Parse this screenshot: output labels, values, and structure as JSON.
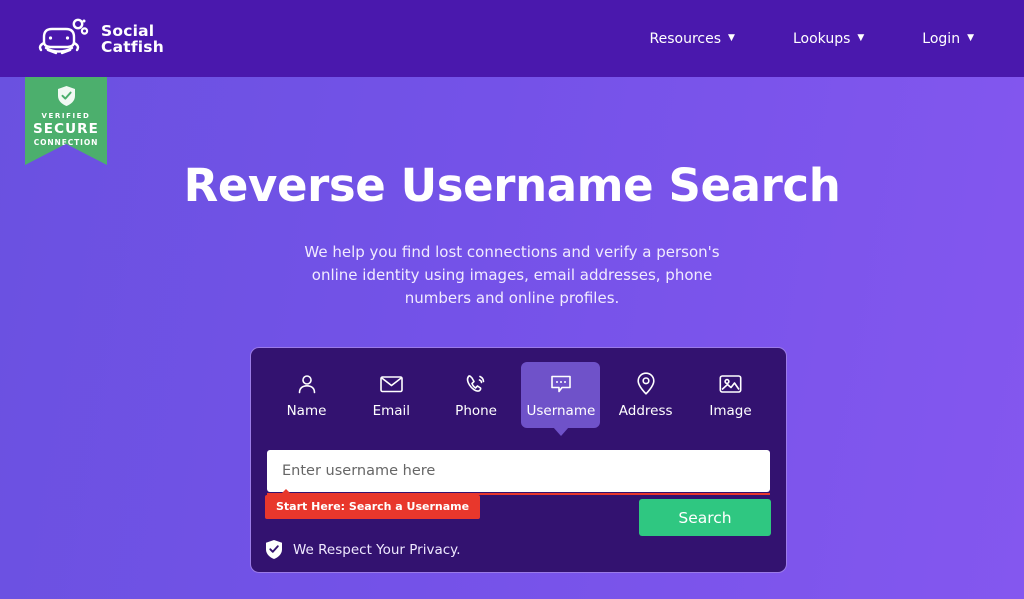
{
  "header": {
    "logo": {
      "icon": "catfish-logo-icon",
      "line1": "Social",
      "line2": "Catfish"
    },
    "nav": [
      {
        "label": "Resources",
        "caret": "▼"
      },
      {
        "label": "Lookups",
        "caret": "▼"
      },
      {
        "label": "Login",
        "caret": "▼"
      }
    ]
  },
  "secure_badge": {
    "icon": "shield-check-icon",
    "line1": "VERIFIED",
    "line2": "SECURE",
    "line3": "CONNECTION",
    "color": "#4caf6d"
  },
  "hero": {
    "title": "Reverse Username Search",
    "subtitle": "We help you find lost connections and verify a person's online identity using images, email addresses, phone numbers and online profiles."
  },
  "search_card": {
    "tabs": [
      {
        "label": "Name",
        "icon": "person-icon",
        "active": false
      },
      {
        "label": "Email",
        "icon": "envelope-icon",
        "active": false
      },
      {
        "label": "Phone",
        "icon": "phone-icon",
        "active": false
      },
      {
        "label": "Username",
        "icon": "chat-bubble-icon",
        "active": true
      },
      {
        "label": "Address",
        "icon": "map-pin-icon",
        "active": false
      },
      {
        "label": "Image",
        "icon": "photo-icon",
        "active": false
      }
    ],
    "input": {
      "value": "",
      "placeholder": "Enter username here"
    },
    "tooltip": {
      "text": "Start Here: Search a Username",
      "color": "#e8372c"
    },
    "search_button": {
      "label": "Search",
      "color": "#2fc781"
    },
    "privacy": {
      "icon": "shield-check-icon",
      "text": "We Respect Your Privacy."
    }
  },
  "theme": {
    "header_bg": "#4a18ad",
    "body_gradient_start": "#6a51e0",
    "body_gradient_end": "#8457ef",
    "card_bg": "#331270",
    "card_border": "#9b7be8",
    "active_tab_bg": "#6f52c9"
  }
}
